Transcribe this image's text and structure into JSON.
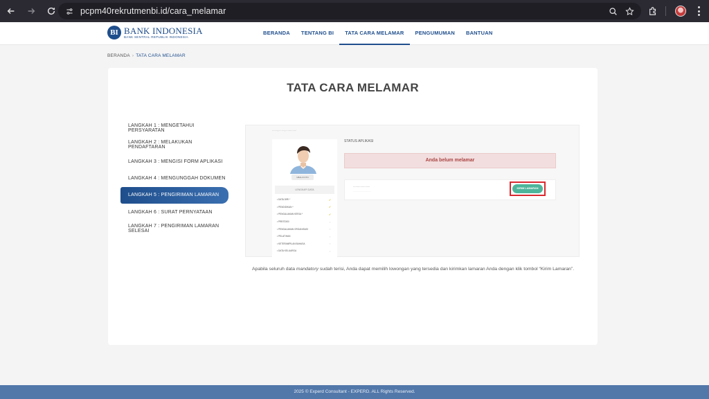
{
  "browser": {
    "url": "pcpm40rekrutmenbi.id/cara_melamar"
  },
  "header": {
    "logo_name": "BANK INDONESIA",
    "logo_sub": "BANK SENTRAL REPUBLIK INDONESIA",
    "nav": [
      {
        "label": "BERANDA"
      },
      {
        "label": "TENTANG BI"
      },
      {
        "label": "TATA CARA MELAMAR"
      },
      {
        "label": "PENGUMUMAN"
      },
      {
        "label": "BANTUAN"
      }
    ],
    "active_nav": "TATA CARA MELAMAR"
  },
  "breadcrumb": {
    "home": "BERANDA",
    "current": "TATA CARA MELAMAR"
  },
  "main": {
    "title": "TATA CARA MELAMAR",
    "steps": [
      {
        "label": "LANGKAH 1 : MENGETAHUI PERSYARATAN"
      },
      {
        "label": "LANGKAH 2 : MELAKUKAN PENDAFTARAN"
      },
      {
        "label": "LANGKAH 3 : MENGISI FORM APLIKASI"
      },
      {
        "label": "LANGKAH 4 : MENGUNGGAH DOKUMEN"
      },
      {
        "label": "LANGKAH 5 : PENGIRIMAN LAMARAN"
      },
      {
        "label": "LANGKAH 6 : SURAT PERNYATAAN"
      },
      {
        "label": "LANGKAH 7 : PENGIRIMAN LAMARAN SELESAI"
      }
    ],
    "active_step": 5,
    "illustration": {
      "status_title": "STATUS APLIKASI",
      "alert": "Anda belum melamar",
      "button": "KIRIM LAMARAN"
    },
    "description_before": "Apabila seluruh data ",
    "description_em": "mandatory",
    "description_after": " sudah terisi, Anda dapat memilih lowongan yang tersedia dan kirimkan lamaran Anda dengan klik tombol “Kirim Lamaran”."
  },
  "footer": {
    "text": "2025 © Experd Consultant - EXPERD. ALL Rights Reserved."
  },
  "colors": {
    "brand": "#1f4e8c",
    "footer": "#5278aa",
    "alert_bg": "#f2dede",
    "kirim_button": "#4eb59b",
    "highlight_border": "#d9282f"
  }
}
